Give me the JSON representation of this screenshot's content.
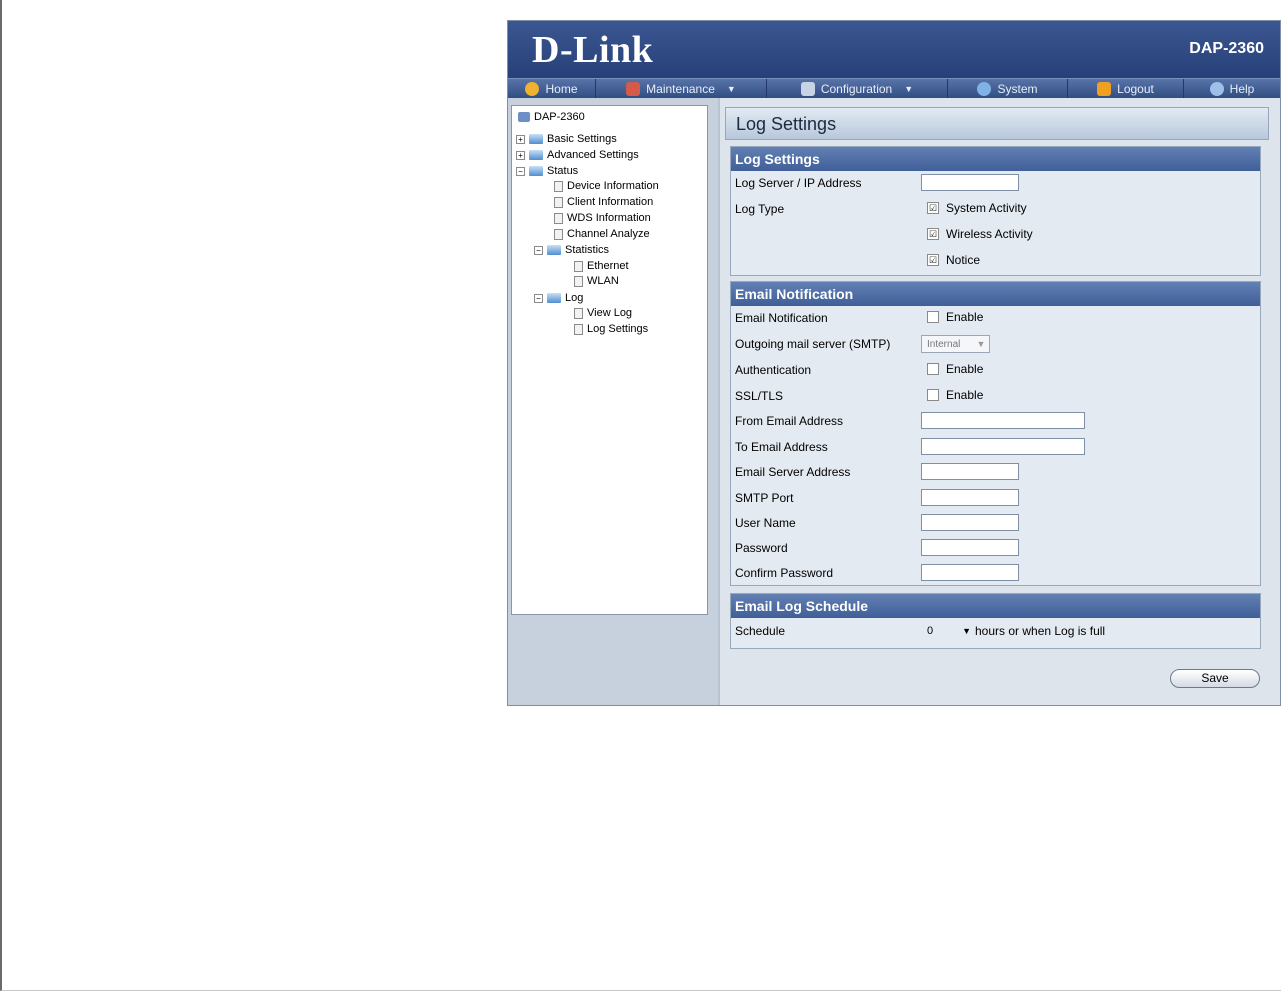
{
  "header": {
    "logo": "D-Link",
    "model": "DAP-2360"
  },
  "nav": [
    {
      "label": "Home",
      "icon": "home-icon"
    },
    {
      "label": "Maintenance",
      "icon": "tools-icon"
    },
    {
      "label": "Configuration",
      "icon": "disk-icon"
    },
    {
      "label": "System",
      "icon": "bird-icon"
    },
    {
      "label": "Logout",
      "icon": "logout-icon"
    },
    {
      "label": "Help",
      "icon": "help-icon"
    }
  ],
  "tree": {
    "root": "DAP-2360",
    "basic": "Basic Settings",
    "advanced": "Advanced Settings",
    "status": "Status",
    "device_info": "Device Information",
    "client_info": "Client Information",
    "wds_info": "WDS Information",
    "channel": "Channel Analyze",
    "statistics": "Statistics",
    "ethernet": "Ethernet",
    "wlan": "WLAN",
    "log": "Log",
    "view_log": "View Log",
    "log_settings": "Log Settings"
  },
  "page_title": "Log Settings",
  "log_settings": {
    "title": "Log Settings",
    "server_label": "Log Server / IP Address",
    "server_value": "",
    "type_label": "Log Type",
    "system_activity": "System Activity",
    "wireless_activity": "Wireless Activity",
    "notice": "Notice",
    "checked": "☑"
  },
  "email": {
    "title": "Email Notification",
    "notif_label": "Email Notification",
    "enable": "Enable",
    "smtp_label": "Outgoing mail server (SMTP)",
    "smtp_value": "Internal",
    "auth_label": "Authentication",
    "ssl_label": "SSL/TLS",
    "from_label": "From Email Address",
    "to_label": "To Email Address",
    "server_label": "Email Server Address",
    "port_label": "SMTP Port",
    "user_label": "User Name",
    "password_label": "Password",
    "confirm_label": "Confirm Password"
  },
  "schedule": {
    "title": "Email Log Schedule",
    "label": "Schedule",
    "value": "0",
    "suffix": "hours or when Log is full"
  },
  "save_label": "Save"
}
